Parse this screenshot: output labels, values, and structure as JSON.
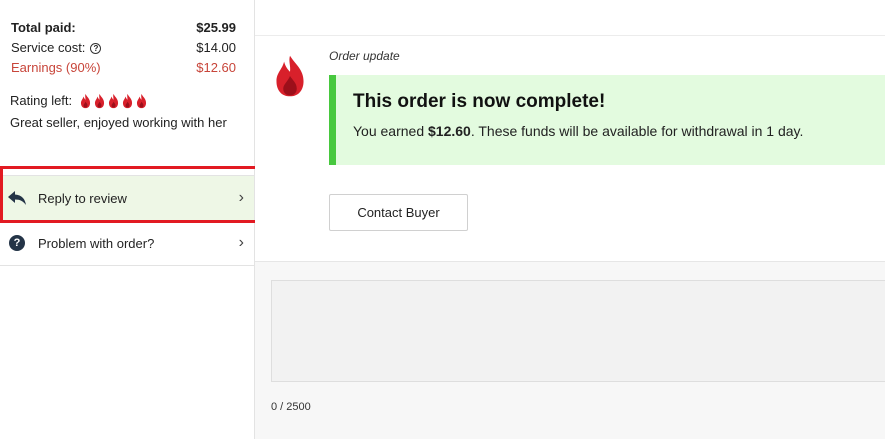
{
  "summary": {
    "total_paid_label": "Total paid:",
    "total_paid_value": "$25.99",
    "service_cost_label": "Service cost:",
    "service_cost_value": "$14.00",
    "earnings_label": "Earnings (90%)",
    "earnings_value": "$12.60"
  },
  "rating": {
    "label": "Rating left:",
    "stars": 5,
    "review": "Great seller, enjoyed working with her"
  },
  "menu": {
    "reply_label": "Reply to review",
    "problem_label": "Problem with order?"
  },
  "order_update": {
    "label": "Order update",
    "title": "This order is now complete!",
    "msg_prefix": "You earned ",
    "amount": "$12.60",
    "msg_suffix": ". These funds will be available for withdrawal in 1 day.",
    "contact_label": "Contact Buyer"
  },
  "compose": {
    "counter": "0 / 2500"
  },
  "colors": {
    "accent_red": "#c8453a",
    "flame_red": "#d8202b",
    "complete_bg": "#e3fbdf",
    "complete_border": "#47c83e",
    "highlight_box": "#e21a22"
  }
}
